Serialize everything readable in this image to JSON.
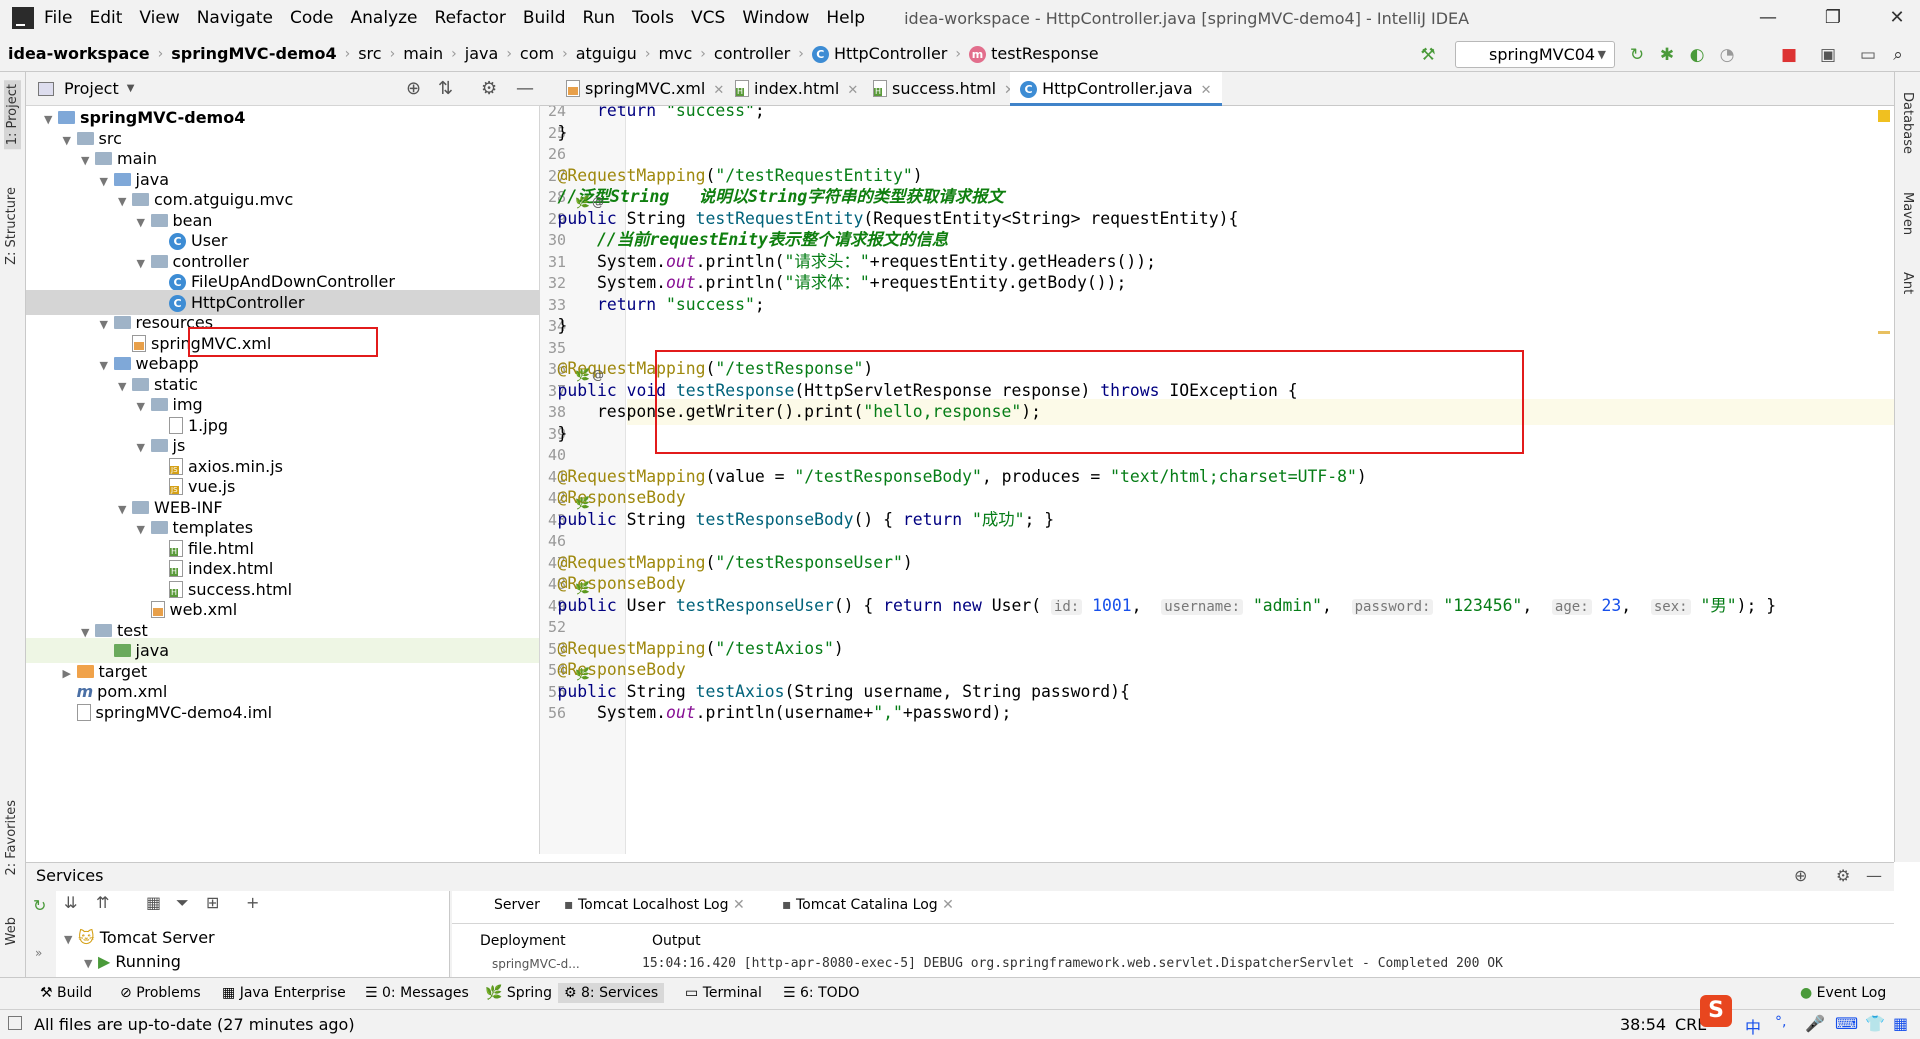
{
  "menubar": {
    "items": [
      "File",
      "Edit",
      "View",
      "Navigate",
      "Code",
      "Analyze",
      "Refactor",
      "Build",
      "Run",
      "Tools",
      "VCS",
      "Window",
      "Help"
    ],
    "title": "idea-workspace - HttpController.java [springMVC-demo4] - IntelliJ IDEA"
  },
  "breadcrumb": [
    "idea-workspace",
    "springMVC-demo4",
    "src",
    "main",
    "java",
    "com",
    "atguigu",
    "mvc",
    "controller",
    "HttpController",
    "testResponse"
  ],
  "run_config": "springMVC04",
  "project": {
    "header": "Project",
    "tree": [
      {
        "label": "springMVC-demo4",
        "depth": 0,
        "icon": "module-folder",
        "arrow": "open"
      },
      {
        "label": "src",
        "depth": 1,
        "icon": "folder",
        "arrow": "open"
      },
      {
        "label": "main",
        "depth": 2,
        "icon": "folder",
        "arrow": "open"
      },
      {
        "label": "java",
        "depth": 3,
        "icon": "source-folder",
        "arrow": "open"
      },
      {
        "label": "com.atguigu.mvc",
        "depth": 4,
        "icon": "package",
        "arrow": "open"
      },
      {
        "label": "bean",
        "depth": 5,
        "icon": "package",
        "arrow": "open"
      },
      {
        "label": "User",
        "depth": 6,
        "icon": "class",
        "arrow": ""
      },
      {
        "label": "controller",
        "depth": 5,
        "icon": "package",
        "arrow": "open"
      },
      {
        "label": "FileUpAndDownController",
        "depth": 6,
        "icon": "class",
        "arrow": ""
      },
      {
        "label": "HttpController",
        "depth": 6,
        "icon": "class",
        "arrow": "",
        "selected": true
      },
      {
        "label": "resources",
        "depth": 3,
        "icon": "resources",
        "arrow": "open"
      },
      {
        "label": "springMVC.xml",
        "depth": 4,
        "icon": "xml",
        "arrow": ""
      },
      {
        "label": "webapp",
        "depth": 3,
        "icon": "web-folder",
        "arrow": "open"
      },
      {
        "label": "static",
        "depth": 4,
        "icon": "folder",
        "arrow": "open"
      },
      {
        "label": "img",
        "depth": 5,
        "icon": "folder",
        "arrow": "open"
      },
      {
        "label": "1.jpg",
        "depth": 6,
        "icon": "image",
        "arrow": ""
      },
      {
        "label": "js",
        "depth": 5,
        "icon": "folder",
        "arrow": "open"
      },
      {
        "label": "axios.min.js",
        "depth": 6,
        "icon": "js",
        "arrow": ""
      },
      {
        "label": "vue.js",
        "depth": 6,
        "icon": "js",
        "arrow": ""
      },
      {
        "label": "WEB-INF",
        "depth": 4,
        "icon": "folder",
        "arrow": "open"
      },
      {
        "label": "templates",
        "depth": 5,
        "icon": "folder",
        "arrow": "open"
      },
      {
        "label": "file.html",
        "depth": 6,
        "icon": "html",
        "arrow": ""
      },
      {
        "label": "index.html",
        "depth": 6,
        "icon": "html",
        "arrow": ""
      },
      {
        "label": "success.html",
        "depth": 6,
        "icon": "html",
        "arrow": ""
      },
      {
        "label": "web.xml",
        "depth": 5,
        "icon": "xml",
        "arrow": ""
      },
      {
        "label": "test",
        "depth": 2,
        "icon": "folder",
        "arrow": "open"
      },
      {
        "label": "java",
        "depth": 3,
        "icon": "test-folder",
        "arrow": "",
        "highlight": true
      },
      {
        "label": "target",
        "depth": 1,
        "icon": "excluded-folder",
        "arrow": "closed"
      },
      {
        "label": "pom.xml",
        "depth": 1,
        "icon": "maven",
        "arrow": ""
      },
      {
        "label": "springMVC-demo4.iml",
        "depth": 1,
        "icon": "iml",
        "arrow": ""
      }
    ]
  },
  "editor_tabs": [
    {
      "label": "springMVC.xml",
      "active": false
    },
    {
      "label": "index.html",
      "active": false
    },
    {
      "label": "success.html",
      "active": false
    },
    {
      "label": "HttpController.java",
      "active": true
    }
  ],
  "code": {
    "line_numbers": [
      "24",
      "25",
      "26",
      "27",
      "28",
      "29",
      "30",
      "31",
      "32",
      "33",
      "34",
      "35",
      "36",
      "37",
      "38",
      "39",
      "40",
      "41",
      "42",
      "43",
      "46",
      "47",
      "48",
      "49",
      "52",
      "53",
      "54",
      "55",
      "56"
    ],
    "lines": [
      "        return \"success\";",
      "    }",
      "",
      "    @RequestMapping(\"/testRequestEntity\")",
      "    //泛型String   说明以String字符串的类型获取请求报文",
      "    public String testRequestEntity(RequestEntity<String> requestEntity){",
      "        //当前requestEnity表示整个请求报文的信息",
      "        System.out.println(\"请求头：\"+requestEntity.getHeaders());",
      "        System.out.println(\"请求体：\"+requestEntity.getBody());",
      "        return \"success\";",
      "    }",
      "",
      "    @RequestMapping(\"/testResponse\")",
      "    public void testResponse(HttpServletResponse response) throws IOException {",
      "        response.getWriter().print(\"hello,response\");",
      "    }",
      "",
      "    @RequestMapping(value = \"/testResponseBody\", produces = \"text/html;charset=UTF-8\")",
      "    @ResponseBody",
      "    public String testResponseBody() { return \"成功\"; }",
      "",
      "    @RequestMapping(\"/testResponseUser\")",
      "    @ResponseBody",
      "    public User testResponseUser() { return new User( id: 1001,  username: \"admin\",  password: \"123456\",  age: 23,  sex: \"男\"); }",
      "",
      "    @RequestMapping(\"/testAxios\")",
      "    @ResponseBody",
      "    public String testAxios(String username, String password){",
      "        System.out.println(username+\",\"+password);"
    ]
  },
  "services": {
    "title": "Services",
    "tree": [
      "Tomcat Server",
      "Running"
    ],
    "tabs": [
      "Server",
      "Tomcat Localhost Log",
      "Tomcat Catalina Log"
    ],
    "deployment_label": "Deployment",
    "output_label": "Output",
    "output_text": "15:04:16.420 [http-apr-8080-exec-5] DEBUG org.springframework.web.servlet.DispatcherServlet - Completed 200 OK",
    "deployment_item": "springMVC-d..."
  },
  "bottom_tools": [
    "Build",
    "Problems",
    "Java Enterprise",
    "0: Messages",
    "Spring",
    "8: Services",
    "Terminal",
    "6: TODO",
    "Event Log"
  ],
  "left_strip": [
    "1: Project",
    "Z: Structure",
    "2: Favorites",
    "Web"
  ],
  "right_strip": [
    "Database",
    "Maven",
    "Ant"
  ],
  "status": {
    "message": "All files are up-to-date (27 minutes ago)",
    "position": "38:54",
    "encoding": "CRL",
    "ime": "中"
  },
  "colors": {
    "highlight_box": "#e21b1b",
    "keyword": "#000080",
    "string": "#067d17",
    "annotation": "#9e880d"
  }
}
